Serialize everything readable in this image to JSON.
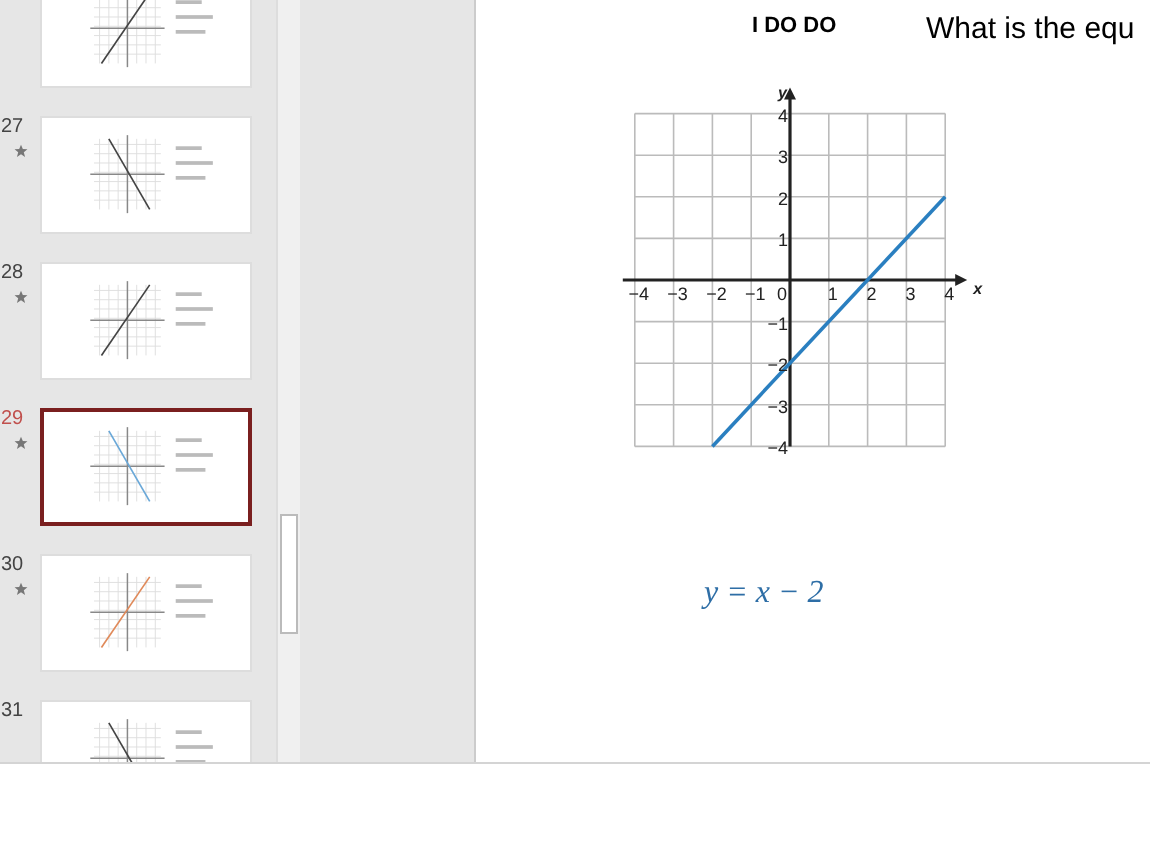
{
  "slide_panel": {
    "slides": [
      {
        "star": false,
        "selected": false
      },
      {
        "number": "27",
        "star": true,
        "selected": false
      },
      {
        "number": "28",
        "star": true,
        "selected": false
      },
      {
        "number": "29",
        "star": true,
        "selected": true
      },
      {
        "number": "30",
        "star": true,
        "selected": false
      },
      {
        "number": "31",
        "star": false,
        "selected": false
      }
    ]
  },
  "slide": {
    "heading": "I DO DO",
    "question": "What is the equ",
    "equation": "y = x − 2",
    "chart_data": {
      "type": "line",
      "grid": true,
      "xlabel": "x",
      "ylabel": "y",
      "x": [
        -2,
        4
      ],
      "series": [
        {
          "color": "#2a7fc0",
          "values": [
            -4,
            2
          ]
        }
      ],
      "xlim": [
        -4,
        4
      ],
      "ylim": [
        -4,
        4
      ],
      "xticks": [
        {
          "value": -4,
          "label": "−4"
        },
        {
          "value": -3,
          "label": "−3"
        },
        {
          "value": -2,
          "label": "−2"
        },
        {
          "value": -1,
          "label": "−1"
        },
        {
          "value": 0,
          "label": "0"
        },
        {
          "value": 1,
          "label": "1"
        },
        {
          "value": 2,
          "label": "2"
        },
        {
          "value": 3,
          "label": "3"
        },
        {
          "value": 4,
          "label": "4"
        }
      ],
      "yticks": [
        {
          "value": -4,
          "label": "−4"
        },
        {
          "value": -3,
          "label": "−3"
        },
        {
          "value": -2,
          "label": "−2"
        },
        {
          "value": -1,
          "label": "−1"
        },
        {
          "value": 1,
          "label": "1"
        },
        {
          "value": 2,
          "label": "2"
        },
        {
          "value": 3,
          "label": "3"
        },
        {
          "value": 4,
          "label": "4"
        }
      ]
    }
  }
}
